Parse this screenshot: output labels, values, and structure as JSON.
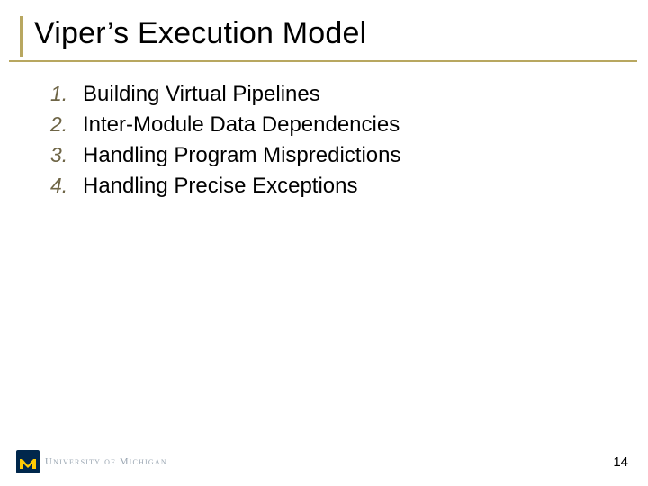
{
  "title": "Viper’s Execution Model",
  "list": {
    "items": [
      {
        "num": "1.",
        "text": "Building Virtual Pipelines"
      },
      {
        "num": "2.",
        "text": "Inter-Module Data Dependencies"
      },
      {
        "num": "3.",
        "text": "Handling Program Mispredictions"
      },
      {
        "num": "4.",
        "text": "Handling Precise Exceptions"
      }
    ]
  },
  "footer": {
    "logo_text": "University of Michigan",
    "page_number": "14"
  },
  "colors": {
    "accent": "#b8a760",
    "logo_bg": "#00274c",
    "logo_m": "#ffcb05"
  }
}
